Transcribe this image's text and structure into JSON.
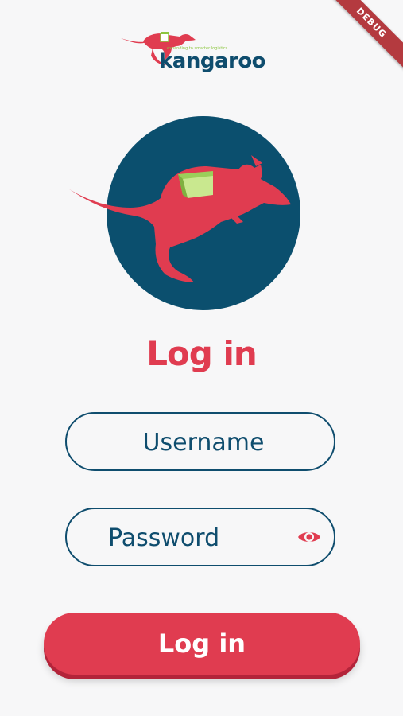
{
  "app": {
    "brand_name": "kangaroo",
    "brand_tagline": "expanding to smarter logistics",
    "debug_label": "DEBUG"
  },
  "colors": {
    "primary_red": "#e03c50",
    "navy": "#0f4d6e",
    "accent_green": "#8cc63f",
    "background": "#f7f7f8"
  },
  "login": {
    "title": "Log in",
    "username_placeholder": "Username",
    "password_placeholder": "Password",
    "password_toggle_icon": "eye-icon",
    "submit_label": "Log in"
  }
}
